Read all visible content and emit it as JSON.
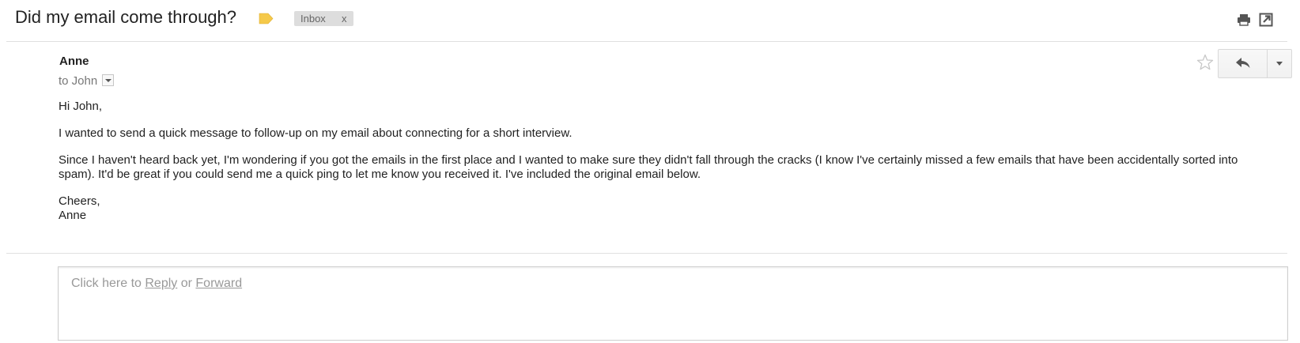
{
  "header": {
    "subject": "Did my email come through?",
    "label_icon": "label-tag-icon",
    "label_color": "#f5c94a",
    "inbox_chip": {
      "label": "Inbox",
      "remove": "x"
    },
    "print_icon": "print-icon",
    "new_window_icon": "new-window-icon"
  },
  "message": {
    "sender": "Anne",
    "recipient": "to John",
    "star_icon": "star-outline-icon",
    "reply_icon": "reply-arrow-icon",
    "more_icon": "chevron-down-icon",
    "body": {
      "greeting": "Hi John,",
      "paragraph_1": "I wanted to send a quick message to follow-up on my email about connecting for a short interview.",
      "paragraph_2": "Since I haven't heard back yet, I'm wondering if you got the emails in the first place and I wanted to make sure they didn't fall through the cracks (I know I've certainly missed a few emails that have been accidentally sorted into spam). It'd be great if you could send me a quick ping to let me know you received it. I've included the original email below.",
      "closing": "Cheers,",
      "signature": "Anne"
    }
  },
  "reply_box": {
    "prefix": "Click here to ",
    "reply_link": "Reply",
    "middle": " or ",
    "forward_link": "Forward"
  }
}
